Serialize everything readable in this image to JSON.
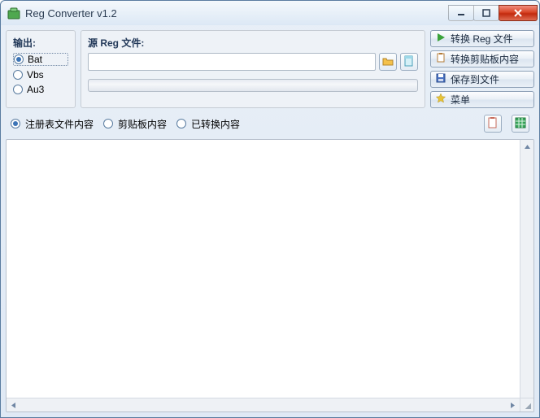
{
  "titlebar": {
    "title": "Reg Converter v1.2"
  },
  "output": {
    "legend": "输出:",
    "options": [
      "Bat",
      "Vbs",
      "Au3"
    ],
    "selected": 0
  },
  "source": {
    "legend": "源 Reg 文件:",
    "value": "",
    "placeholder": ""
  },
  "icons": {
    "browse": "folder-icon",
    "clear": "page-icon",
    "copy": "clipboard-icon",
    "table": "grid-icon"
  },
  "side": {
    "convert": "转换 Reg 文件",
    "convert_clip": "转换剪贴板内容",
    "save": "保存到文件",
    "menu": "菜单"
  },
  "view": {
    "options": [
      "注册表文件内容",
      "剪贴板内容",
      "已转换内容"
    ],
    "selected": 0
  },
  "content": {
    "text": ""
  }
}
